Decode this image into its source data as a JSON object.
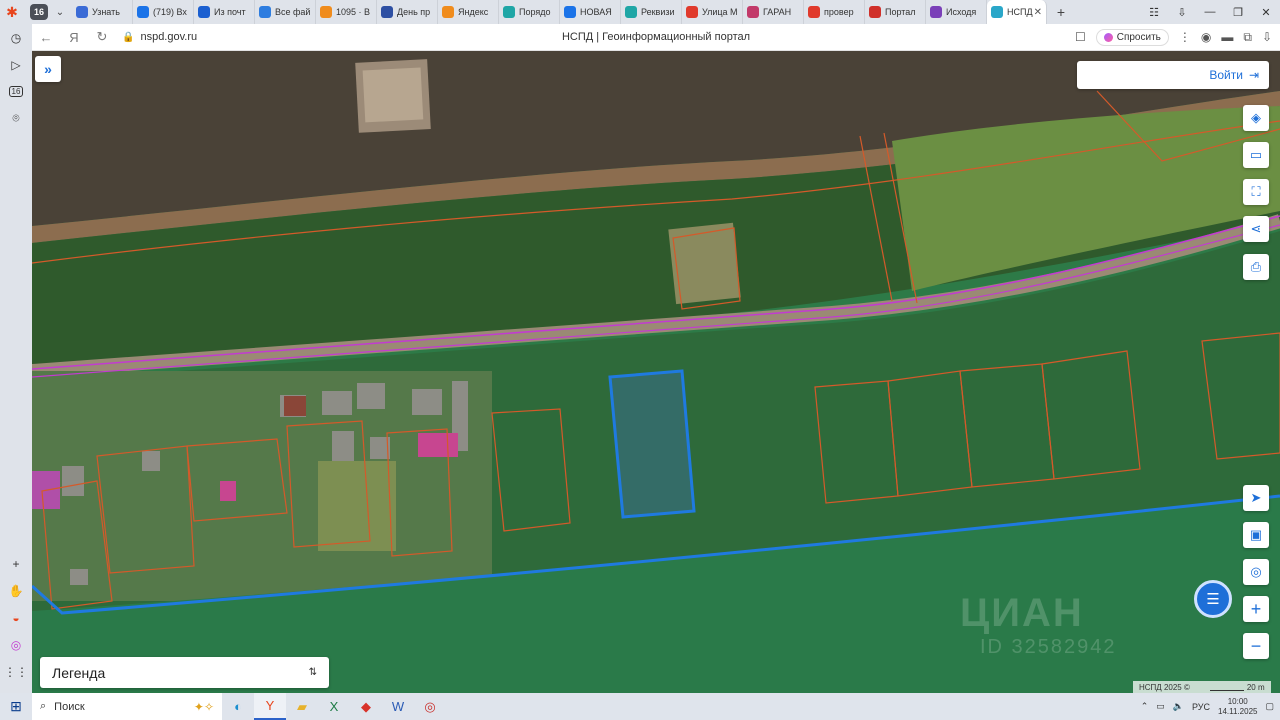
{
  "browser": {
    "tab_count": "16",
    "tabs": [
      {
        "title": "Узнать",
        "color": "#3b6bd6"
      },
      {
        "title": "(719) Вх",
        "color": "#1b73e8"
      },
      {
        "title": "Из почт",
        "color": "#1b5fd0"
      },
      {
        "title": "Все фай",
        "color": "#2e7de0"
      },
      {
        "title": "1095 · В",
        "color": "#f08c1d"
      },
      {
        "title": "День пр",
        "color": "#2d4fa3"
      },
      {
        "title": "Яндекс",
        "color": "#f08c1d"
      },
      {
        "title": "Порядо",
        "color": "#1fa6a6"
      },
      {
        "title": "НОВАЯ",
        "color": "#1b73e8"
      },
      {
        "title": "Реквизи",
        "color": "#1fa6a6"
      },
      {
        "title": "Улица М",
        "color": "#e03a2c"
      },
      {
        "title": "ГАРАН",
        "color": "#c23a6a"
      },
      {
        "title": "провер",
        "color": "#e03a2c"
      },
      {
        "title": "Портал",
        "color": "#d0302a"
      },
      {
        "title": "Исходя",
        "color": "#7a3fb8"
      },
      {
        "title": "НСПД",
        "color": "#2aa7c9"
      }
    ],
    "url": "nspd.gov.ru",
    "page_title": "НСПД | Геоинформационный портал",
    "ask_label": "Спросить"
  },
  "map": {
    "login_label": "Войти",
    "legend_label": "Легенда",
    "attribution": "НСПД 2025 ©",
    "scale_label": "20 m",
    "watermark": "ЦИАН",
    "watermark_id": "ID 32582942",
    "tools": [
      "layers-icon",
      "ruler-icon",
      "select-area-icon",
      "share-icon",
      "print-icon"
    ],
    "right_controls": [
      "locate-icon",
      "minimap-icon",
      "search-location-icon",
      "zoom-in-icon",
      "zoom-out-icon"
    ],
    "highlight_color": "#1f7ae0",
    "parcel_color": "#d45a2a",
    "road_boundary_color": "#c23bd1"
  },
  "taskbar": {
    "search_label": "Поиск",
    "language": "РУС",
    "time": "10:00",
    "date": "14.11.2025"
  }
}
